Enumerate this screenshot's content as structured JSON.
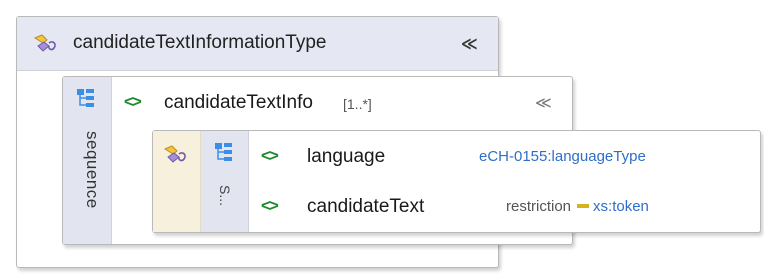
{
  "complex_type": {
    "name": "candidateTextInformationType",
    "collapse_glyph": "≪",
    "icon": "complex-type-icon"
  },
  "element": {
    "name": "candidateTextInfo",
    "cardinality": "[1..*]",
    "collapse_glyph": "≪",
    "compositor_label": "sequence",
    "icon": "element-chevrons-icon"
  },
  "inner": {
    "compositor_label": "S...",
    "children": [
      {
        "name": "language",
        "type": "eCH-0155:languageType"
      },
      {
        "name": "candidateText",
        "restriction_label": "restriction",
        "base_type": "xs:token"
      }
    ]
  },
  "colors": {
    "element_chevron": "#1e8a2e",
    "type_link": "#2f6ec8",
    "restriction_dash": "#d6b21e",
    "header_bg": "#e5e7f2"
  }
}
